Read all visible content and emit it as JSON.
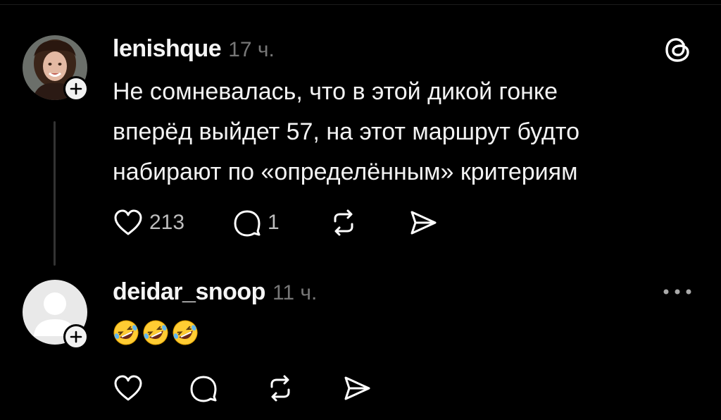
{
  "posts": [
    {
      "username": "lenishque",
      "time": "17 ч.",
      "text_lines": [
        "Не сомневалась, что в этой дикой гонке",
        "вперёд выйдет 57, на этот маршрут будто",
        "набирают по «определённым» критериям"
      ],
      "likes": "213",
      "replies": "1",
      "top_right_icon": "threads-logo-icon",
      "avatar": "profile-photo"
    },
    {
      "username": "deidar_snoop",
      "time": "11 ч.",
      "emojis": [
        "🤣",
        "🤣",
        "🤣"
      ],
      "top_right_icon": "more-options-icon",
      "avatar": "default-avatar-placeholder"
    }
  ],
  "colors": {
    "background": "#000000",
    "text": "#f3f3f3",
    "muted": "#777777",
    "thread_line": "#333333"
  }
}
